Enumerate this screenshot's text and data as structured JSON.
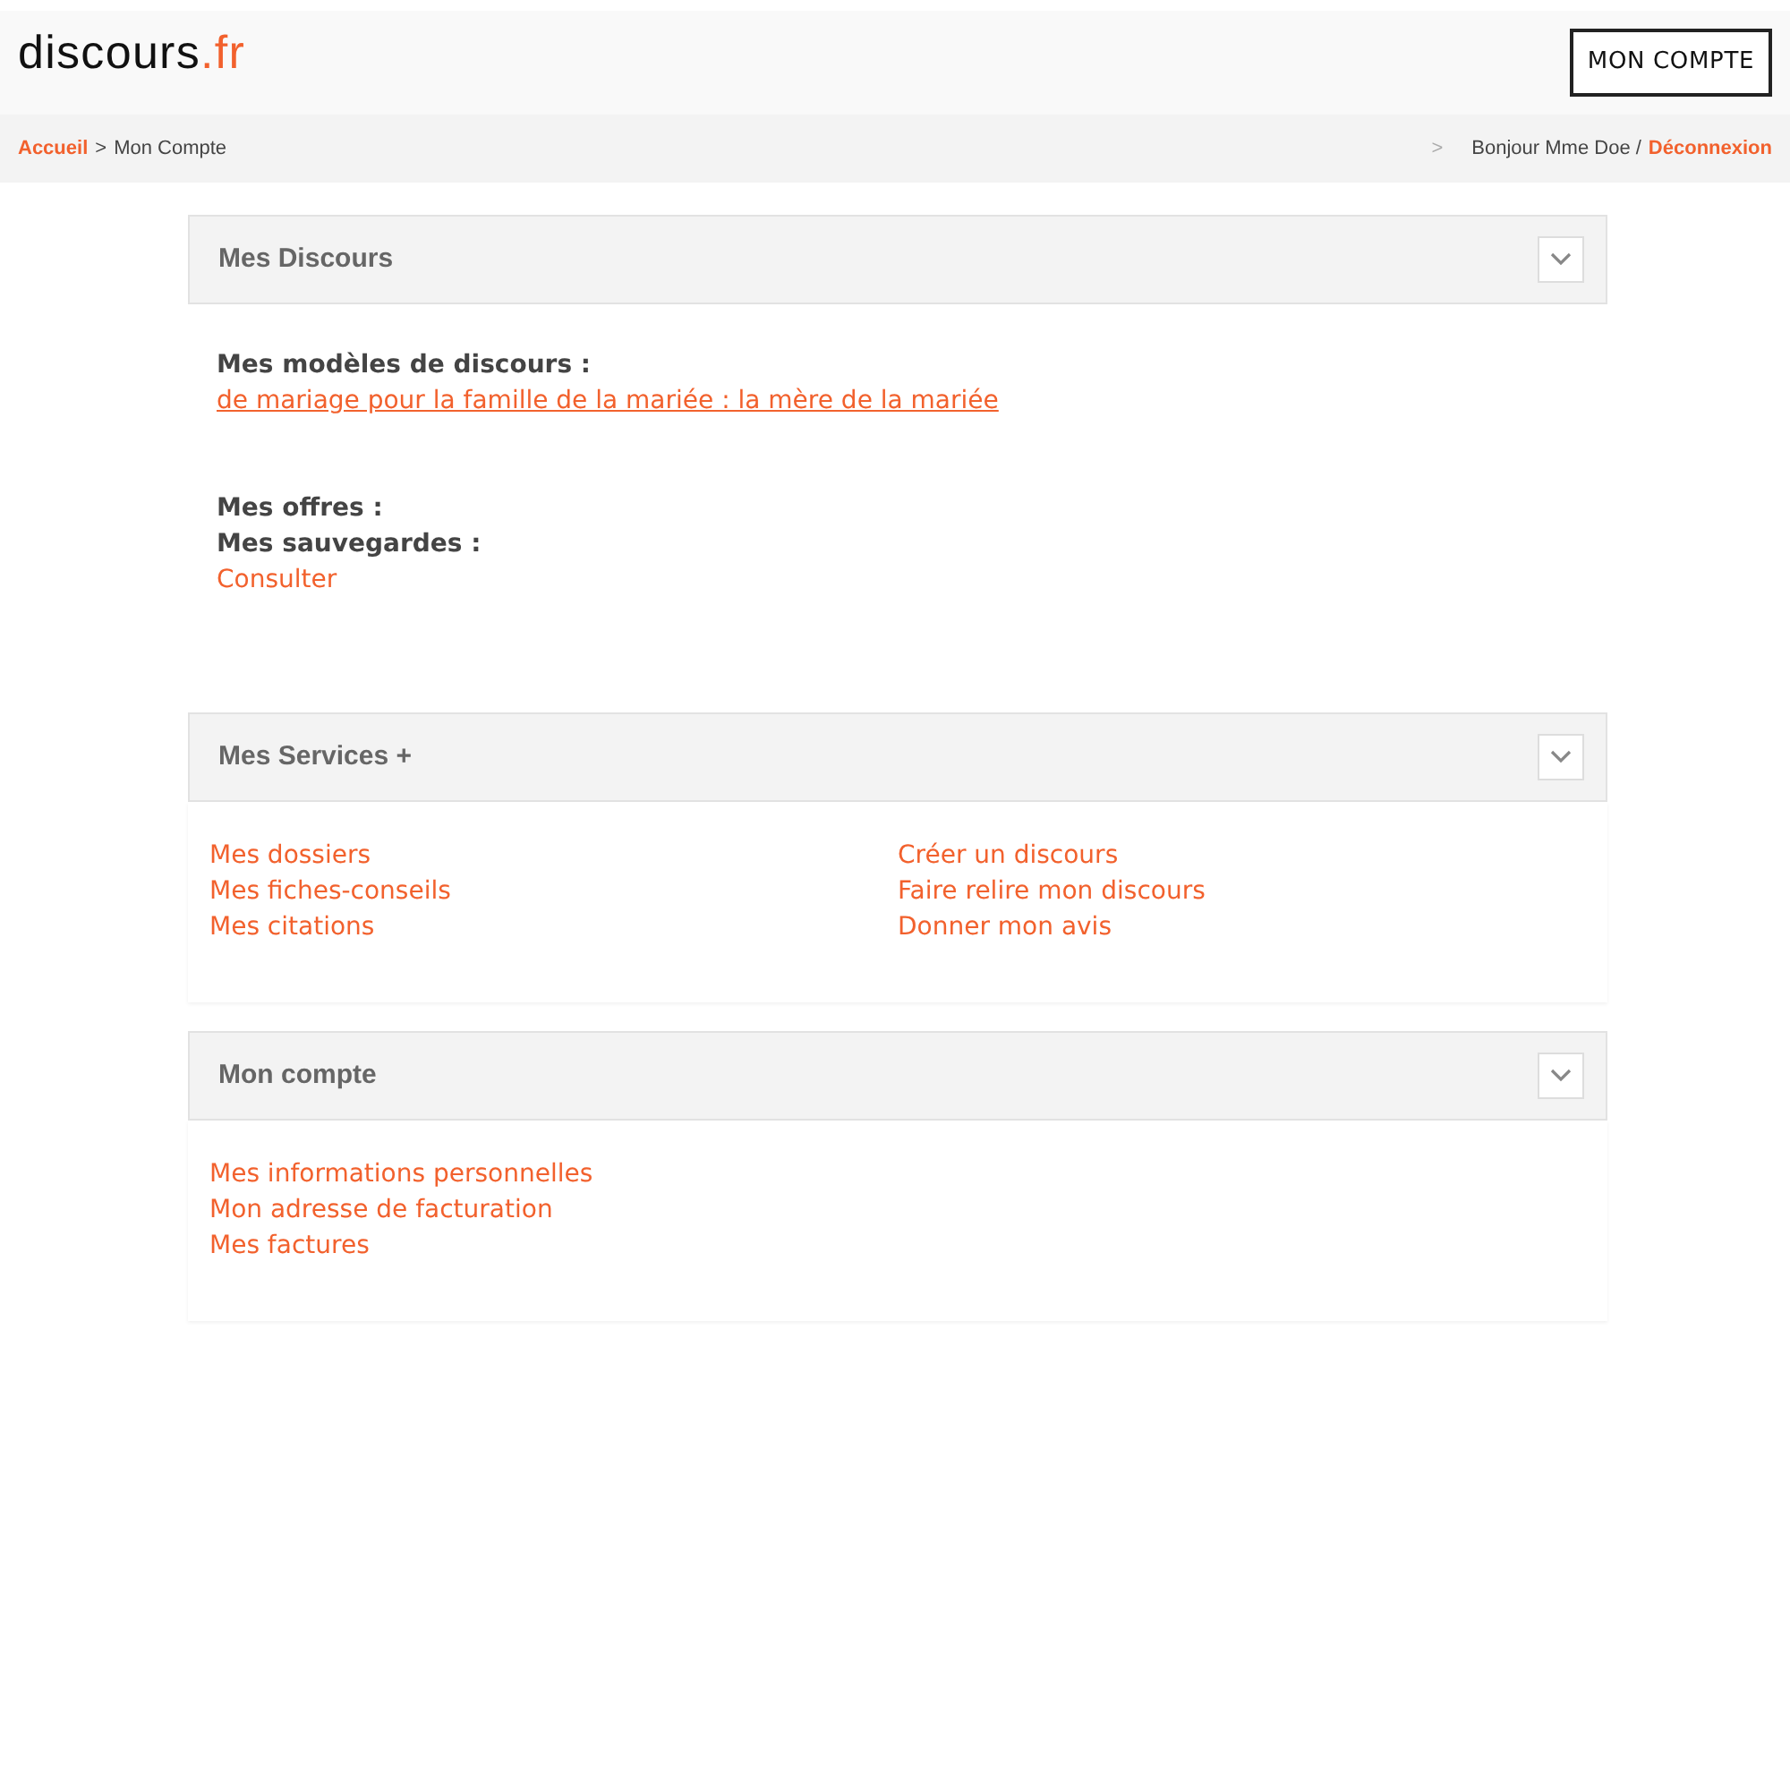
{
  "header": {
    "logo": {
      "name": "discours",
      "suffix": ".fr"
    },
    "account_button": "MON COMPTE"
  },
  "breadcrumb": {
    "home": "Accueil",
    "separator": ">",
    "current": "Mon Compte",
    "user_separator": ">",
    "greeting": "Bonjour Mme Doe /",
    "logout": "Déconnexion"
  },
  "sections": [
    {
      "title": "Mes Discours",
      "kind": "groups",
      "groups": [
        [
          {
            "kind": "label",
            "text": "Mes modèles de discours :"
          },
          {
            "kind": "link",
            "text": "de mariage pour la famille de la mariée : la mère de la mariée",
            "underline": true
          }
        ],
        [
          {
            "kind": "label",
            "text": "Mes offres :"
          },
          {
            "kind": "label",
            "text": "Mes sauvegardes :"
          },
          {
            "kind": "link",
            "text": "Consulter",
            "underline": false
          }
        ]
      ]
    },
    {
      "title": "Mes Services +",
      "kind": "columns",
      "columns": [
        [
          "Mes dossiers",
          "Mes fiches-conseils",
          "Mes citations"
        ],
        [
          "Créer un discours",
          "Faire relire mon discours",
          "Donner mon avis"
        ]
      ]
    },
    {
      "title": "Mon compte",
      "kind": "columns",
      "columns": [
        [
          "Mes informations personnelles",
          "Mon adresse de facturation",
          "Mes factures"
        ]
      ]
    }
  ]
}
